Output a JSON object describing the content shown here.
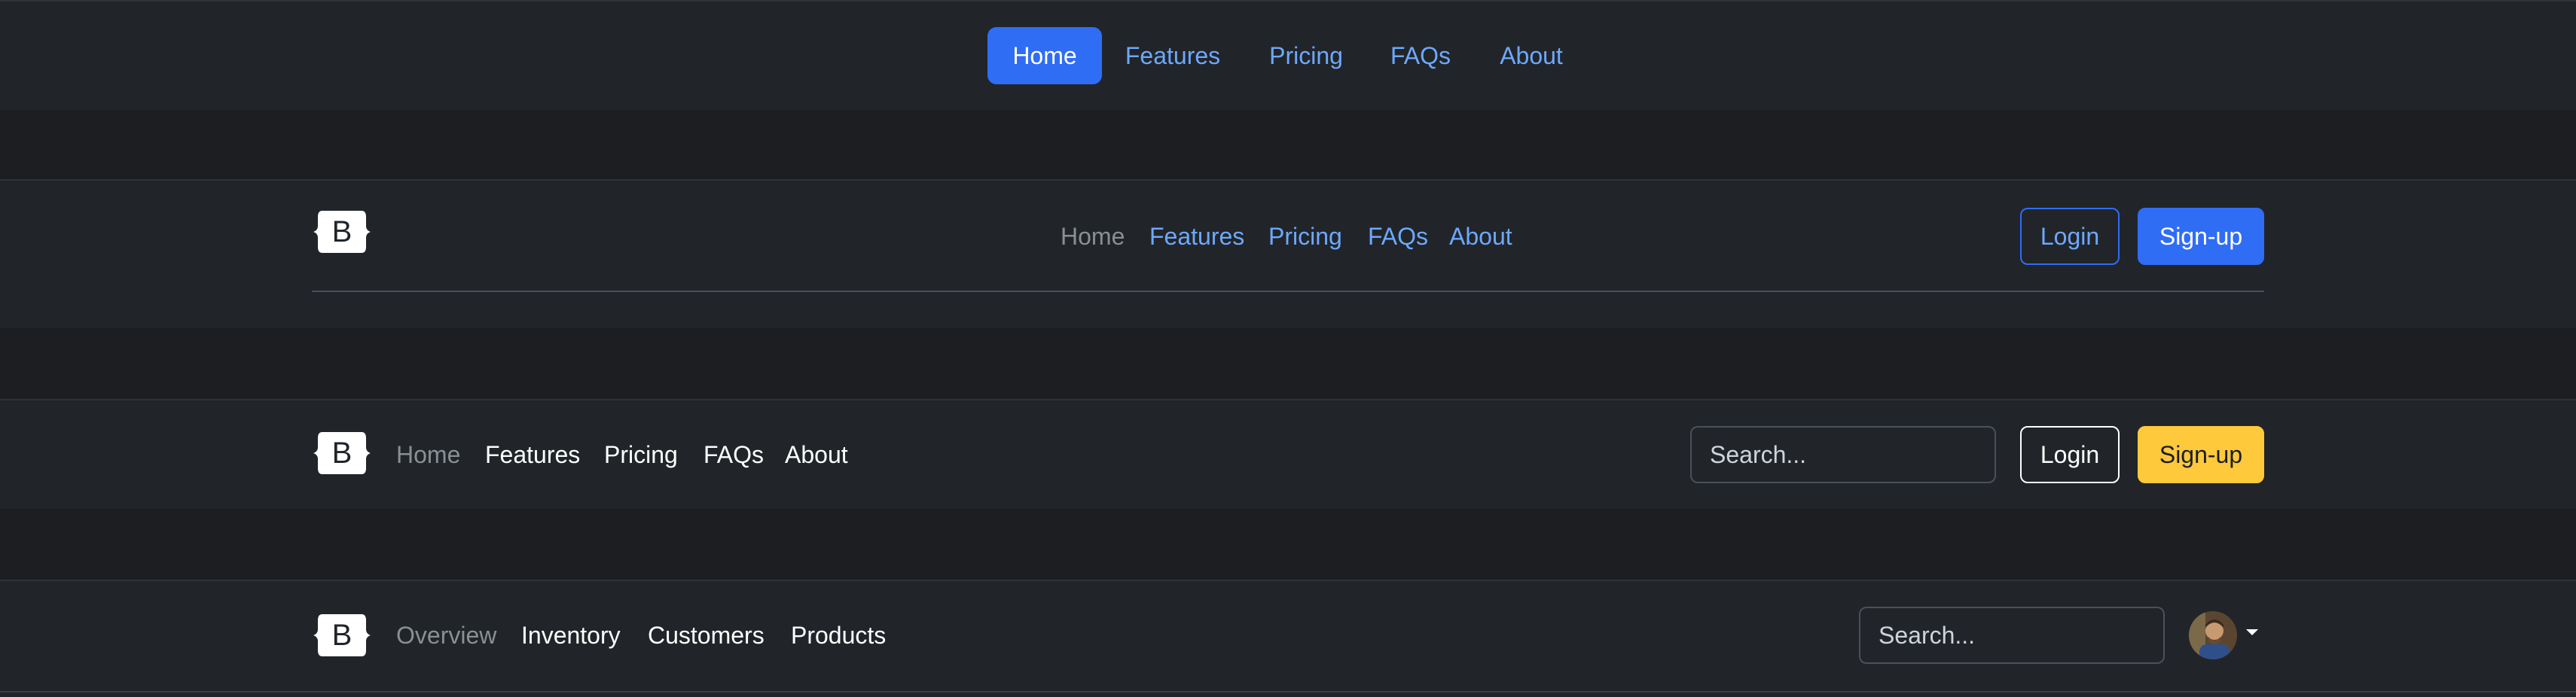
{
  "nav1": {
    "items": [
      "Home",
      "Features",
      "Pricing",
      "FAQs",
      "About"
    ]
  },
  "nav2": {
    "logo_letter": "B",
    "items": [
      "Home",
      "Features",
      "Pricing",
      "FAQs",
      "About"
    ],
    "login": "Login",
    "signup": "Sign-up"
  },
  "nav3": {
    "logo_letter": "B",
    "items": [
      "Home",
      "Features",
      "Pricing",
      "FAQs",
      "About"
    ],
    "search_placeholder": "Search...",
    "login": "Login",
    "signup": "Sign-up"
  },
  "nav4": {
    "logo_letter": "B",
    "items": [
      "Overview",
      "Inventory",
      "Customers",
      "Products"
    ],
    "search_placeholder": "Search..."
  },
  "colors": {
    "primary": "#2f6df5",
    "link": "#6ea8fe",
    "warning": "#ffc93c",
    "muted": "#8a8f94",
    "band": "#212529",
    "gap": "#1c1e22"
  },
  "icons": {
    "logo": "bootstrap-logo-icon",
    "avatar": "user-avatar",
    "caret": "caret-down-icon"
  }
}
